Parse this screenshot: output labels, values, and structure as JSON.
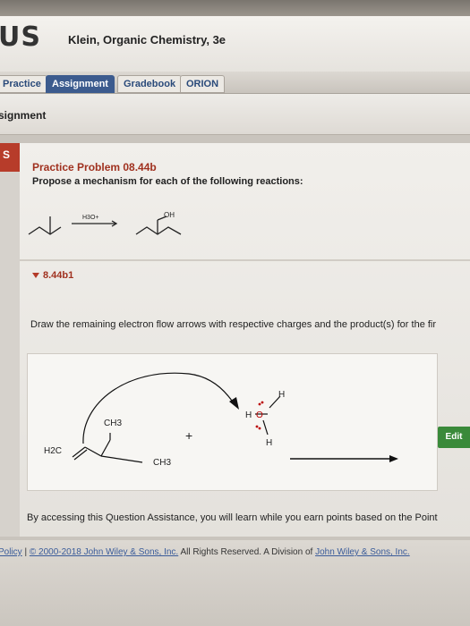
{
  "header": {
    "logo": "US",
    "book_title": "Klein, Organic Chemistry, 3e"
  },
  "nav": {
    "tabs": [
      {
        "label": "Practice",
        "active": false
      },
      {
        "label": "Assignment",
        "active": true
      },
      {
        "label": "Gradebook",
        "active": false
      },
      {
        "label": "ORION",
        "active": false
      }
    ]
  },
  "subheader": {
    "title": "signment"
  },
  "sidebar": {
    "letter": "S"
  },
  "problem": {
    "title": "Practice Problem 08.44b",
    "prompt": "Propose a mechanism for each of the following reactions:",
    "reagent": "H3O+",
    "product_label": "OH"
  },
  "section": {
    "id": "8.44b1",
    "instruction": "Draw the remaining electron flow arrows with respective charges and the product(s) for the fir"
  },
  "drawing": {
    "labels": {
      "ch3_top": "CH3",
      "ch3_right": "CH3",
      "h2c": "H2C",
      "plus": "+",
      "h_top": "H",
      "h_left": "H",
      "o": "O",
      "h_bottom": "H"
    }
  },
  "edit_button": "Edit",
  "assistance": "By accessing this Question Assistance, you will learn while you earn points based on the Point",
  "footer": {
    "policy": "Policy",
    "sep": "|",
    "copyright_link": "© 2000-2018 John Wiley & Sons, Inc.",
    "rights": "All Rights Reserved. A Division of",
    "company_link": "John Wiley & Sons, Inc."
  }
}
